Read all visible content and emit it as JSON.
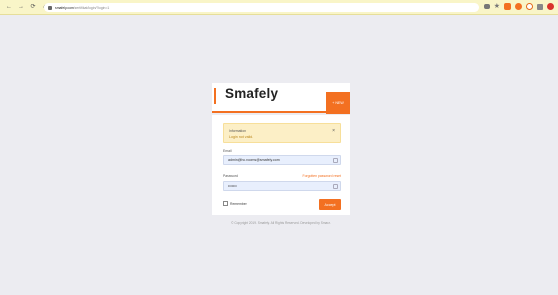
{
  "browser": {
    "nav_icons": [
      "←",
      "→",
      "⟳",
      "⌂"
    ],
    "url_host": "smafely.com",
    "url_path": "/zertifikat/login/?login=1"
  },
  "brand": {
    "title": "Smafely",
    "new_button": "+ NEW"
  },
  "alert": {
    "title": "Information",
    "message": "Login not valid."
  },
  "form": {
    "email_label": "Email",
    "email_value": "admin@hc.rooms@smafely.com",
    "password_label": "Password",
    "forgot_label": "Forgotten password reset",
    "password_value": "•••••••",
    "remember_label": "Remember",
    "submit_label": "Accept"
  },
  "footer": {
    "text": "© Copyright 2019. Smafely. All Rights Reserved. Developed by Smarz."
  },
  "colors": {
    "accent": "#f37021",
    "background": "#ececf1",
    "alert_bg": "#fcefc6"
  }
}
